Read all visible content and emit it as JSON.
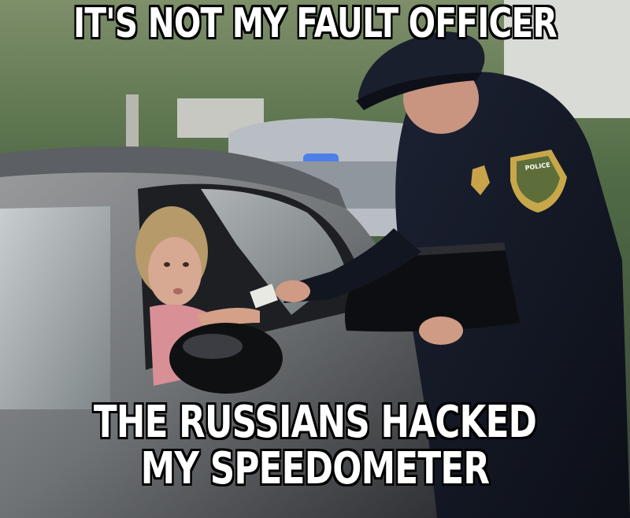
{
  "meme": {
    "top_text": "IT'S NOT MY FAULT OFFICER",
    "bottom_text": [
      "THE RUSSIANS HACKED",
      "MY SPEEDOMETER"
    ],
    "badge_text": "POLICE"
  }
}
